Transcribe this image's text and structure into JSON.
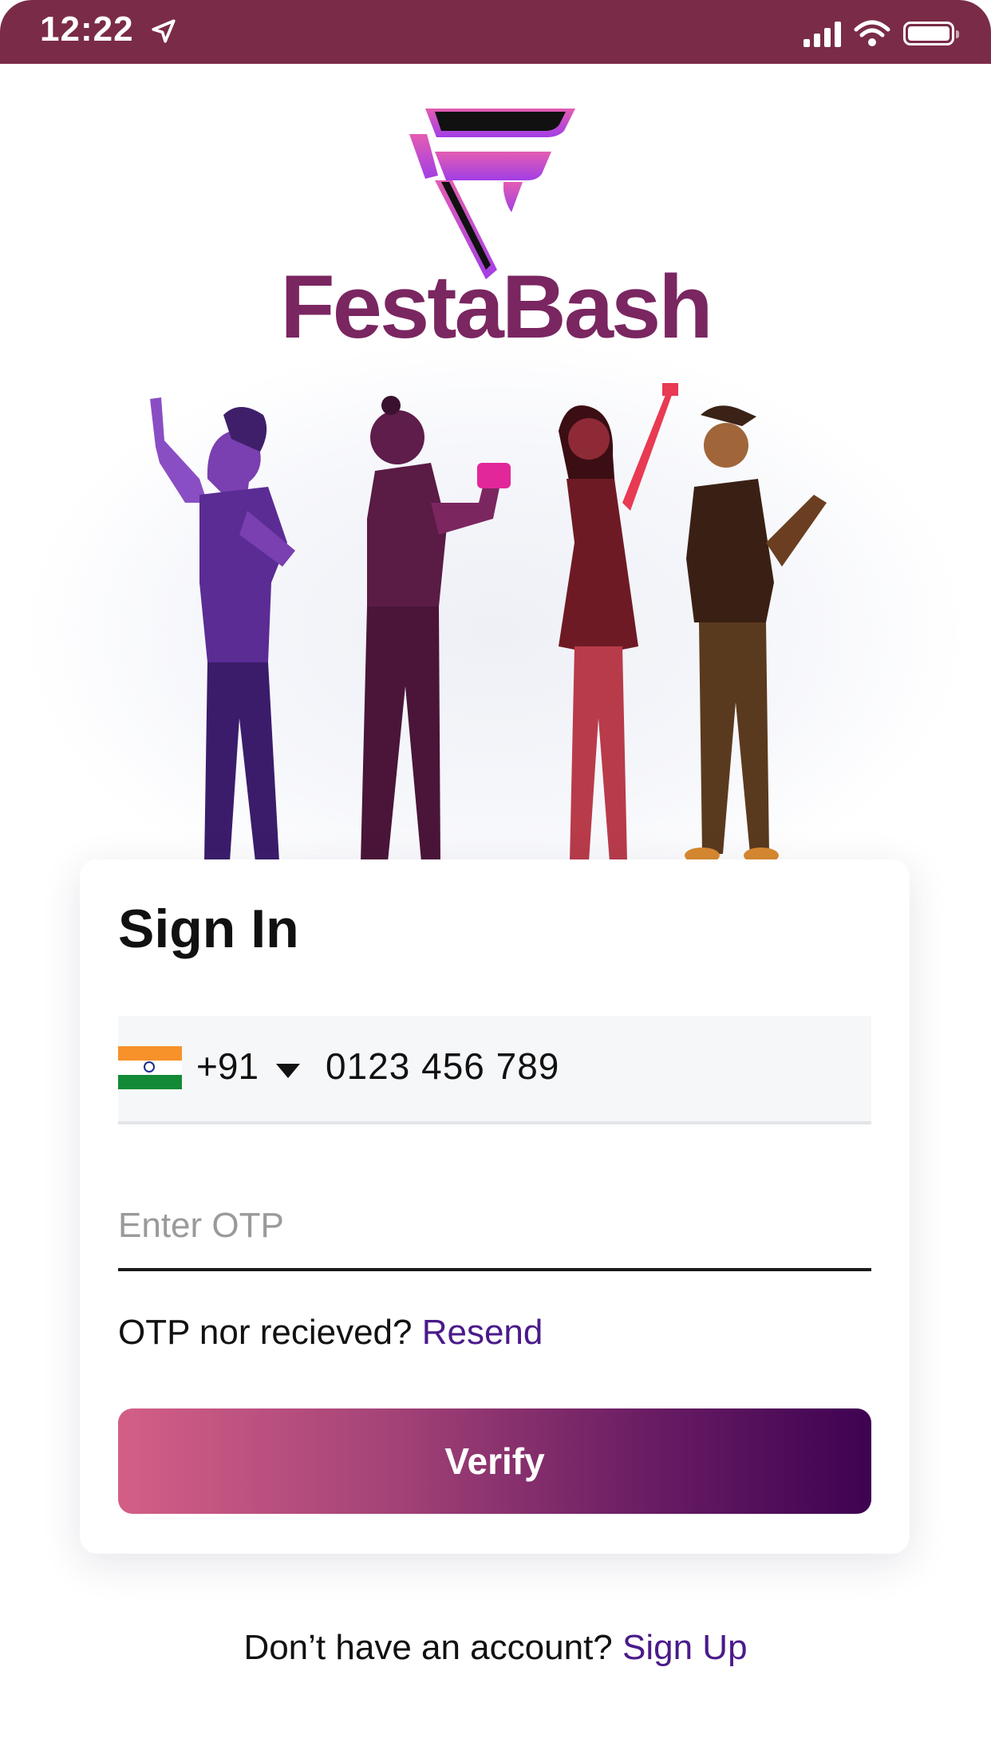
{
  "status_bar": {
    "time": "12:22",
    "icons": [
      "location-arrow-icon",
      "signal-icon",
      "wifi-icon",
      "battery-icon"
    ]
  },
  "brand": {
    "name": "FestaBash",
    "color": "#7a2661",
    "logo_colors": [
      "#b34ce8",
      "#e15bb7",
      "#111111"
    ]
  },
  "signin": {
    "title": "Sign In",
    "phone": {
      "flag": "india-flag-icon",
      "country_code": "+91",
      "number": "0123 456 789"
    },
    "otp": {
      "placeholder": "Enter OTP",
      "value": ""
    },
    "resend_prompt": "OTP nor recieved?",
    "resend_link": "Resend",
    "verify_label": "Verify"
  },
  "footer": {
    "prompt": "Don’t have an account?",
    "link": "Sign Up"
  },
  "colors": {
    "status_bar": "#7a2b47",
    "accent_link": "#4b1a8a",
    "button_gradient": [
      "#d35f87",
      "#3e0252"
    ]
  }
}
